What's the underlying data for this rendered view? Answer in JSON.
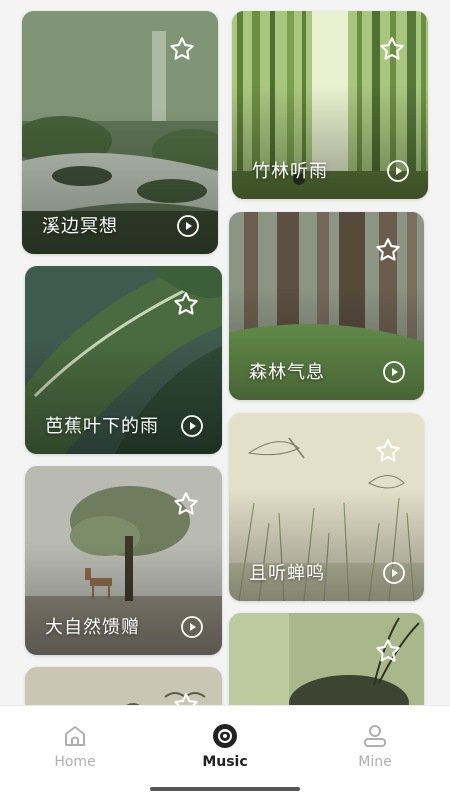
{
  "cards": [
    {
      "id": "c1",
      "title": "溪边冥想"
    },
    {
      "id": "c2",
      "title": "竹林听雨"
    },
    {
      "id": "c3",
      "title": "芭蕉叶下的雨"
    },
    {
      "id": "c4",
      "title": "森林气息"
    },
    {
      "id": "c5",
      "title": "大自然馈赠"
    },
    {
      "id": "c6",
      "title": "且听蝉鸣"
    },
    {
      "id": "c7",
      "title": ""
    },
    {
      "id": "c8",
      "title": ""
    }
  ],
  "nav": {
    "home": "Home",
    "music": "Music",
    "mine": "Mine",
    "active": "music"
  },
  "colors": {
    "background": "#f4f4f4",
    "nav_active": "#222222",
    "nav_inactive": "#b0b0b0",
    "card_text": "#ffffff"
  },
  "icons": {
    "favorite": "star-outline-icon",
    "play": "play-circle-icon",
    "home": "home-icon",
    "music": "vinyl-disc-icon",
    "mine": "user-icon"
  }
}
